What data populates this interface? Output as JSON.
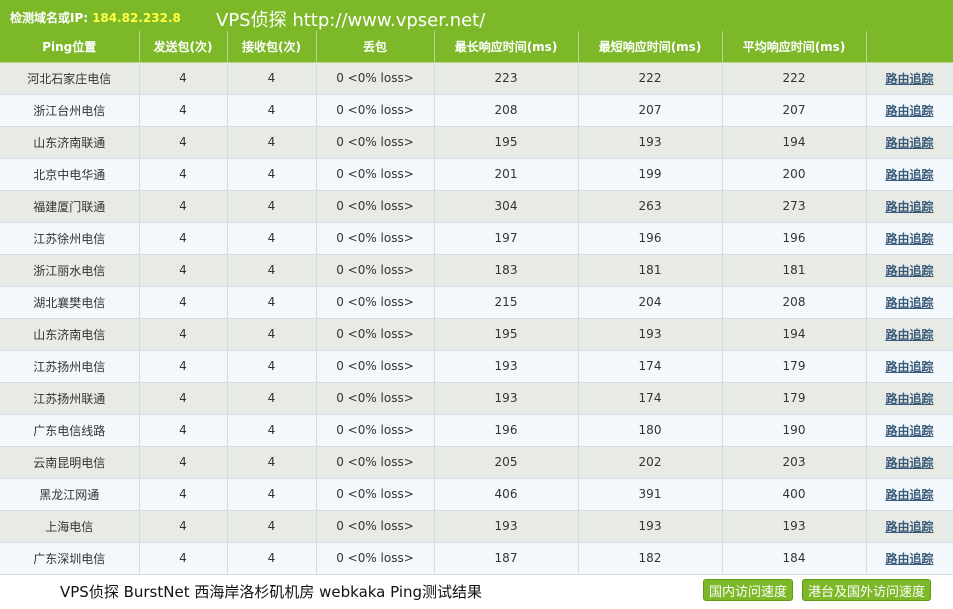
{
  "header": {
    "ip_label": "检测域名或IP:",
    "ip_value": "184.82.232.8",
    "site_title": "VPS侦探 http://www.vpser.net/"
  },
  "columns": [
    "Ping位置",
    "发送包(次)",
    "接收包(次)",
    "丢包",
    "最长响应时间(ms)",
    "最短响应时间(ms)",
    "平均响应时间(ms)",
    ""
  ],
  "rows": [
    {
      "location": "河北石家庄电信",
      "sent": "4",
      "recv": "4",
      "loss": "0 <0% loss>",
      "max": "223",
      "min": "222",
      "avg": "222",
      "trace": "路由追踪"
    },
    {
      "location": "浙江台州电信",
      "sent": "4",
      "recv": "4",
      "loss": "0 <0% loss>",
      "max": "208",
      "min": "207",
      "avg": "207",
      "trace": "路由追踪"
    },
    {
      "location": "山东济南联通",
      "sent": "4",
      "recv": "4",
      "loss": "0 <0% loss>",
      "max": "195",
      "min": "193",
      "avg": "194",
      "trace": "路由追踪"
    },
    {
      "location": "北京中电华通",
      "sent": "4",
      "recv": "4",
      "loss": "0 <0% loss>",
      "max": "201",
      "min": "199",
      "avg": "200",
      "trace": "路由追踪"
    },
    {
      "location": "福建厦门联通",
      "sent": "4",
      "recv": "4",
      "loss": "0 <0% loss>",
      "max": "304",
      "min": "263",
      "avg": "273",
      "trace": "路由追踪"
    },
    {
      "location": "江苏徐州电信",
      "sent": "4",
      "recv": "4",
      "loss": "0 <0% loss>",
      "max": "197",
      "min": "196",
      "avg": "196",
      "trace": "路由追踪"
    },
    {
      "location": "浙江丽水电信",
      "sent": "4",
      "recv": "4",
      "loss": "0 <0% loss>",
      "max": "183",
      "min": "181",
      "avg": "181",
      "trace": "路由追踪"
    },
    {
      "location": "湖北襄樊电信",
      "sent": "4",
      "recv": "4",
      "loss": "0 <0% loss>",
      "max": "215",
      "min": "204",
      "avg": "208",
      "trace": "路由追踪"
    },
    {
      "location": "山东济南电信",
      "sent": "4",
      "recv": "4",
      "loss": "0 <0% loss>",
      "max": "195",
      "min": "193",
      "avg": "194",
      "trace": "路由追踪"
    },
    {
      "location": "江苏扬州电信",
      "sent": "4",
      "recv": "4",
      "loss": "0 <0% loss>",
      "max": "193",
      "min": "174",
      "avg": "179",
      "trace": "路由追踪"
    },
    {
      "location": "江苏扬州联通",
      "sent": "4",
      "recv": "4",
      "loss": "0 <0% loss>",
      "max": "193",
      "min": "174",
      "avg": "179",
      "trace": "路由追踪"
    },
    {
      "location": "广东电信线路",
      "sent": "4",
      "recv": "4",
      "loss": "0 <0% loss>",
      "max": "196",
      "min": "180",
      "avg": "190",
      "trace": "路由追踪"
    },
    {
      "location": "云南昆明电信",
      "sent": "4",
      "recv": "4",
      "loss": "0 <0% loss>",
      "max": "205",
      "min": "202",
      "avg": "203",
      "trace": "路由追踪"
    },
    {
      "location": "黑龙江网通",
      "sent": "4",
      "recv": "4",
      "loss": "0 <0% loss>",
      "max": "406",
      "min": "391",
      "avg": "400",
      "trace": "路由追踪"
    },
    {
      "location": "上海电信",
      "sent": "4",
      "recv": "4",
      "loss": "0 <0% loss>",
      "max": "193",
      "min": "193",
      "avg": "193",
      "trace": "路由追踪"
    },
    {
      "location": "广东深圳电信",
      "sent": "4",
      "recv": "4",
      "loss": "0 <0% loss>",
      "max": "187",
      "min": "182",
      "avg": "184",
      "trace": "路由追踪"
    }
  ],
  "footer": {
    "caption": "VPS侦探 BurstNet 西海岸洛杉矶机房 webkaka Ping测试结果",
    "domestic_button": "国内访问速度",
    "foreign_button": "港台及国外访问速度"
  },
  "colors": {
    "header_green": "#7cb828",
    "ip_yellow": "#ffff44",
    "row_odd": "#e8ebe5",
    "row_even": "#f3f8fc",
    "link": "#3a5a7a"
  }
}
